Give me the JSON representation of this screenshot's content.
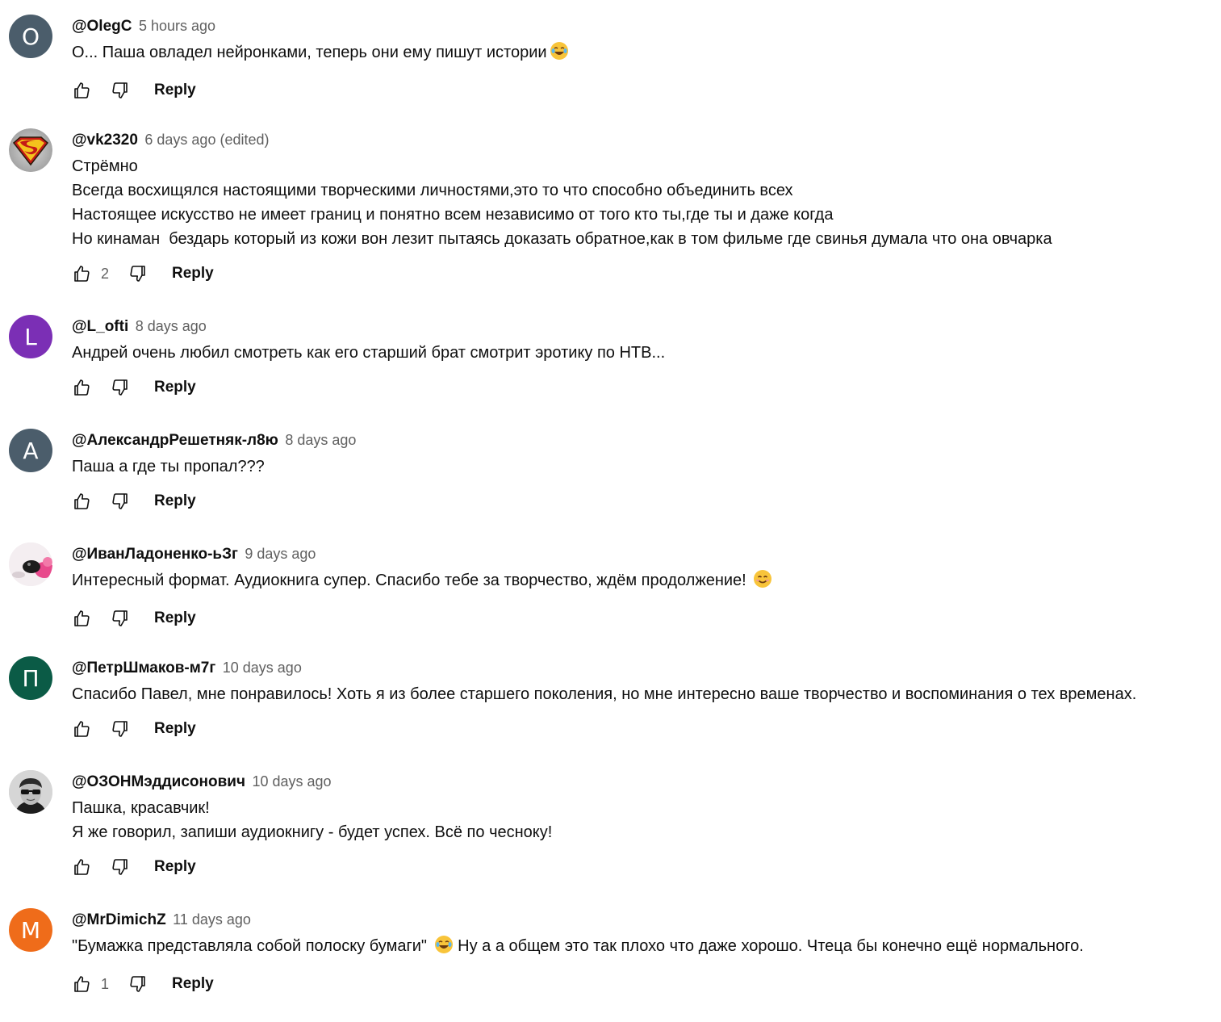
{
  "comments": [
    {
      "author": "@OlegC",
      "time": "5 hours ago",
      "text": "О... Паша овладел нейронками, теперь они ему пишут истории",
      "avatar_letter": "O",
      "avatar_color": "#4b5d6b",
      "likes": "",
      "reply_label": "Reply"
    },
    {
      "author": "@vk2320",
      "time": "6 days ago (edited)",
      "lines": [
        "Стрёмно",
        "Всегда восхищялся настоящими творческими личностями,это то что способно объединить всех",
        "Настоящее искусство не имеет границ и понятно всем независимо от того кто ты,где ты и даже когда",
        "Но кинаман  бездарь который из кожи вон лезит пытаясь доказать обратное,как в том фильме где свинья думала что она овчарка"
      ],
      "avatar_icon": "superman-logo-avatar",
      "likes": "2",
      "reply_label": "Reply"
    },
    {
      "author": "@L_ofti",
      "time": "8 days ago",
      "text": "Андрей очень любил смотреть как его старший брат смотрит эротику по НТВ...",
      "avatar_letter": "L",
      "avatar_color": "#7b2fb5",
      "likes": "",
      "reply_label": "Reply"
    },
    {
      "author": "@АлександрРешетняк-л8ю",
      "time": "8 days ago",
      "text": "Паша а где ты пропал???",
      "avatar_letter": "А",
      "avatar_color": "#4b5d6b",
      "likes": "",
      "reply_label": "Reply"
    },
    {
      "author": "@ИванЛадоненко-ьЗг",
      "time": "9 days ago",
      "text": "Интересный формат. Аудиокнига супер. Спасибо тебе за творчество, ждём продолжение!",
      "avatar_icon": "pink-photo-avatar",
      "likes": "",
      "reply_label": "Reply"
    },
    {
      "author": "@ПетрШмаков-м7г",
      "time": "10 days ago",
      "text": "Спасибо Павел, мне понравилось! Хоть я из более старшего поколения, но мне интересно ваше творчество и воспоминания о тех временах.",
      "avatar_letter": "П",
      "avatar_color": "#0b5b46",
      "likes": "",
      "reply_label": "Reply"
    },
    {
      "author": "@ОЗОНМэддисонович",
      "time": "10 days ago",
      "lines": [
        "Пашка, красавчик!",
        "Я же говорил, запиши аудиокнигу - будет успех. Всё по чесноку!"
      ],
      "avatar_icon": "sunglasses-photo-avatar",
      "likes": "",
      "reply_label": "Reply"
    },
    {
      "author": "@MrDimichZ",
      "time": "11 days ago",
      "text_before": "\"Бумажка представляла собой полоску бумаги\"",
      "text_after": "Ну а а общем это так плохо что даже хорошо. Чтеца бы конечно ещё нормального.",
      "avatar_letter": "M",
      "avatar_color": "#ef6c1a",
      "likes": "1",
      "reply_label": "Reply"
    }
  ]
}
